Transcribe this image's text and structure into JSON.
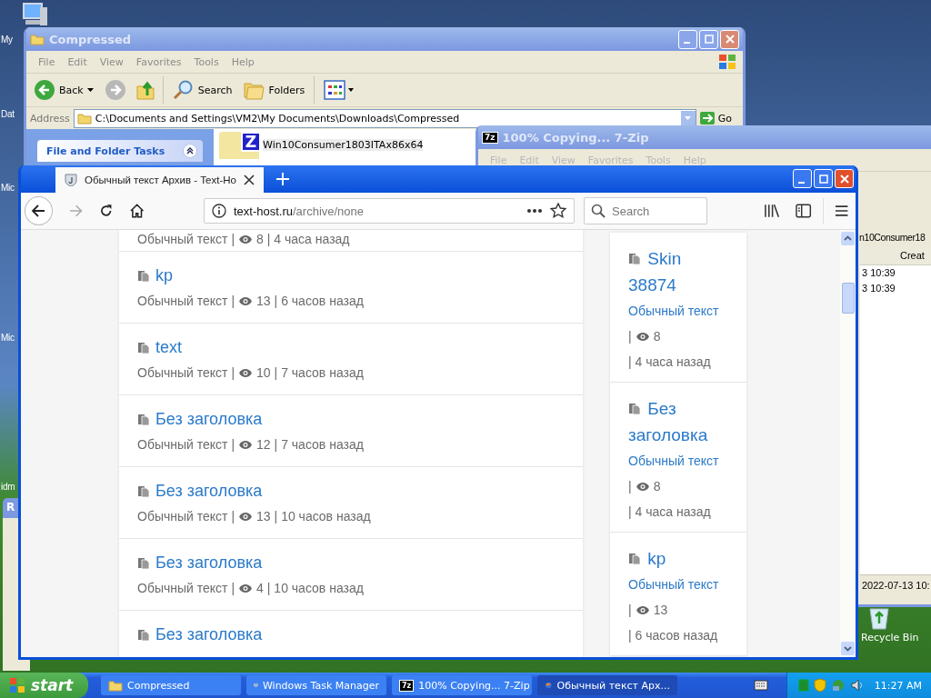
{
  "desktop": {
    "icon_labels": [
      {
        "label": "My"
      },
      {
        "label": "Dat"
      },
      {
        "label": "Mic"
      },
      {
        "label": "Mic"
      },
      {
        "label": "idm"
      }
    ],
    "recycle_bin": "Recycle Bin",
    "partial_window_title": "R"
  },
  "explorer": {
    "title": "Compressed",
    "menu": [
      "File",
      "Edit",
      "View",
      "Favorites",
      "Tools",
      "Help"
    ],
    "back": "Back",
    "search": "Search",
    "folders": "Folders",
    "address_label": "Address",
    "address": "C:\\Documents and Settings\\VM2\\My Documents\\Downloads\\Compressed",
    "go": "Go",
    "task_panel": "File and Folder Tasks",
    "file": {
      "badge": "Z",
      "name": "Win10Consumer1803ITAx86x64"
    }
  },
  "zip_window": {
    "icon_text": "7z",
    "title": "100% Copying... 7-Zip",
    "menu": [
      "File",
      "Edit",
      "View",
      "Favorites",
      "Tools",
      "Help"
    ],
    "path_fragment": "n10Consumer18",
    "column_header": "Creat",
    "rows": [
      "3 10:39",
      "3 10:39"
    ],
    "status": "2022-07-13 10:"
  },
  "browser": {
    "tab": {
      "title": "Обычный текст Архив - Text-Ho",
      "selected": true
    },
    "url_host": "text-host.ru",
    "url_path": "/archive/none",
    "search_placeholder": "Search",
    "top_meta": {
      "category": "Обычный текст |",
      "views": "8",
      "time": "| 4 часа назад"
    },
    "main_items": [
      {
        "title": "kp",
        "category": "Обычный текст |",
        "views": "13",
        "time": "| 6 часов назад"
      },
      {
        "title": "text",
        "category": "Обычный текст |",
        "views": "10",
        "time": "| 7 часов назад"
      },
      {
        "title": "Без заголовка",
        "category": "Обычный текст |",
        "views": "12",
        "time": "| 7 часов назад"
      },
      {
        "title": "Без заголовка",
        "category": "Обычный текст |",
        "views": "13",
        "time": "| 10 часов назад"
      },
      {
        "title": "Без заголовка",
        "category": "Обычный текст |",
        "views": "4",
        "time": "| 10 часов назад"
      },
      {
        "title": "Без заголовка"
      }
    ],
    "side_items": [
      {
        "title": "Skin 38874",
        "category": "Обычный текст",
        "lead": "|",
        "views": "8",
        "time": "| 4 часа назад"
      },
      {
        "title": "Без заголовка",
        "category": "Обычный текст",
        "lead": "|",
        "views": "8",
        "time": "| 4 часа назад"
      },
      {
        "title": "kp",
        "category": "Обычный текст",
        "lead": "|",
        "views": "13",
        "time": "| 6 часов назад"
      }
    ]
  },
  "taskbar": {
    "start": "start",
    "buttons": [
      {
        "kind": "folder",
        "label": "Compressed",
        "selected": false
      },
      {
        "kind": "monitor",
        "label": "Windows Task Manager",
        "selected": false
      },
      {
        "kind": "zip",
        "icon_text": "7z",
        "label": "100% Copying... 7-Zip",
        "selected": false
      },
      {
        "kind": "browser",
        "label": "Обычный текст Арх...",
        "selected": true
      }
    ],
    "clock": "11:27 AM"
  }
}
